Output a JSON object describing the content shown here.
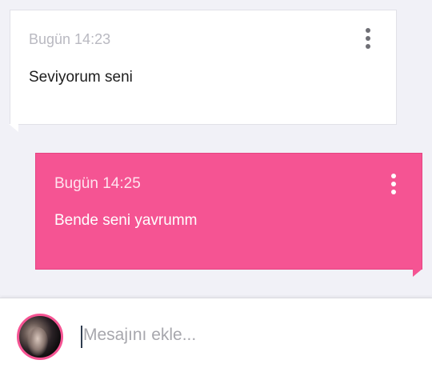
{
  "messages": [
    {
      "direction": "incoming",
      "time": "Bugün 14:23",
      "text": "Seviyorum seni",
      "menu_icon": "more-vertical-icon",
      "bubble_color": "#ffffff"
    },
    {
      "direction": "outgoing",
      "time": "Bugün 14:25",
      "text": "Bende seni yavrumm",
      "menu_icon": "more-vertical-icon",
      "bubble_color": "#f55493"
    }
  ],
  "composer": {
    "placeholder": "Mesajını ekle...",
    "value": "",
    "avatar_border_color": "#f55493"
  },
  "colors": {
    "accent": "#f55493",
    "background": "#f1f1f7"
  }
}
